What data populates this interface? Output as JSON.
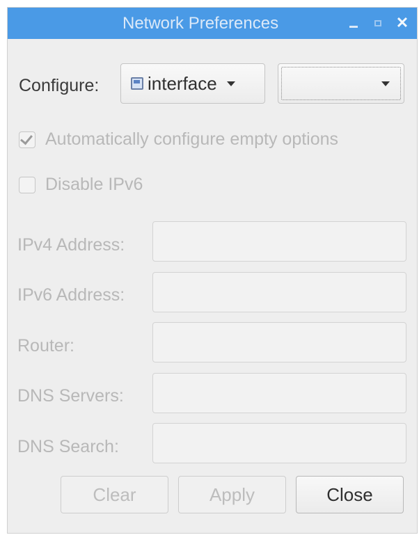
{
  "window": {
    "title": "Network Preferences",
    "controls": {
      "minimize": "minimize-icon",
      "maximize": "maximize-icon",
      "close": "close-icon"
    }
  },
  "configure": {
    "label": "Configure:",
    "type_value": "interface",
    "type_icon": "network-interface-icon",
    "target_value": ""
  },
  "options": {
    "auto_configure": {
      "label": "Automatically configure empty options",
      "checked": true
    },
    "disable_ipv6": {
      "label": "Disable IPv6",
      "checked": false
    }
  },
  "fields": [
    {
      "label": "IPv4 Address:",
      "value": ""
    },
    {
      "label": "IPv6 Address:",
      "value": ""
    },
    {
      "label": "Router:",
      "value": ""
    },
    {
      "label": "DNS Servers:",
      "value": ""
    },
    {
      "label": "DNS Search:",
      "value": ""
    }
  ],
  "buttons": {
    "clear": "Clear",
    "apply": "Apply",
    "close": "Close"
  },
  "colors": {
    "titlebar": "#4a9ae6",
    "window_bg": "#eeeeee",
    "disabled_text": "#b8b8b8"
  }
}
